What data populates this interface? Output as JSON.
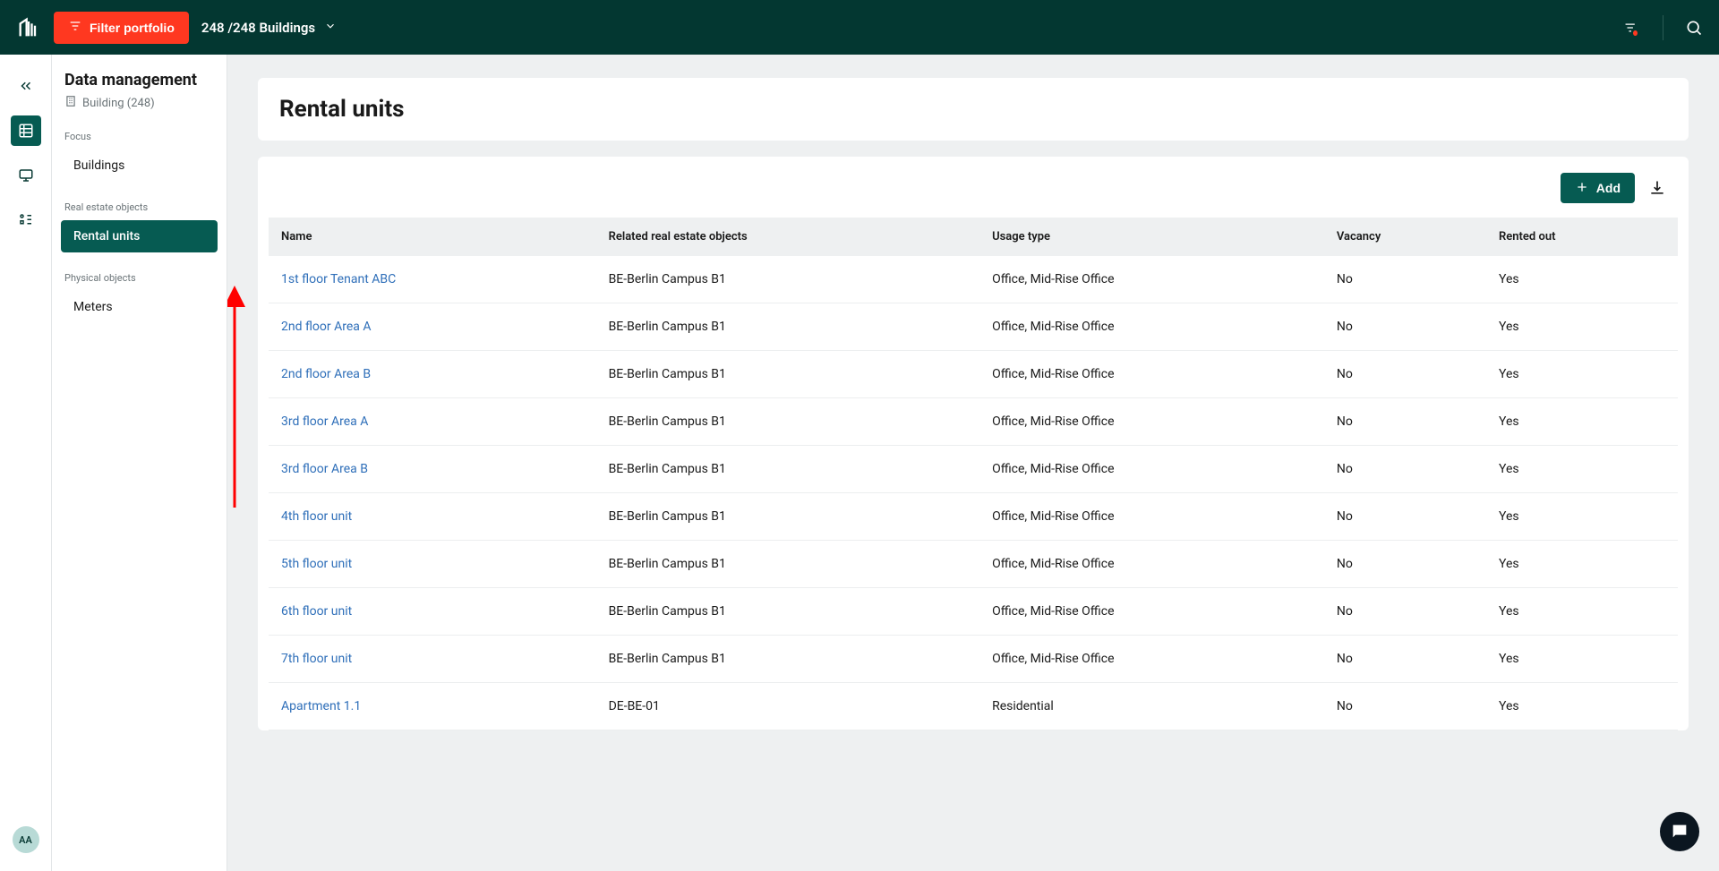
{
  "topbar": {
    "filter_label": "Filter portfolio",
    "building_count_label": "248 /248 Buildings"
  },
  "sidebar": {
    "title": "Data management",
    "subtitle": "Building (248)",
    "groups": [
      {
        "title": "Focus",
        "items": [
          {
            "label": "Buildings",
            "active": false
          }
        ]
      },
      {
        "title": "Real estate objects",
        "items": [
          {
            "label": "Rental units",
            "active": true
          }
        ]
      },
      {
        "title": "Physical objects",
        "items": [
          {
            "label": "Meters",
            "active": false
          }
        ]
      }
    ]
  },
  "rail": {
    "avatar": "AA"
  },
  "page": {
    "title": "Rental units",
    "add_label": "Add",
    "columns": [
      "Name",
      "Related real estate objects",
      "Usage type",
      "Vacancy",
      "Rented out"
    ],
    "rows": [
      {
        "name": "1st floor Tenant ABC",
        "related": "BE-Berlin Campus B1",
        "usage": "Office, Mid-Rise Office",
        "vacancy": "No",
        "rented": "Yes"
      },
      {
        "name": "2nd floor Area A",
        "related": "BE-Berlin Campus B1",
        "usage": "Office, Mid-Rise Office",
        "vacancy": "No",
        "rented": "Yes"
      },
      {
        "name": "2nd floor Area B",
        "related": "BE-Berlin Campus B1",
        "usage": "Office, Mid-Rise Office",
        "vacancy": "No",
        "rented": "Yes"
      },
      {
        "name": "3rd floor Area A",
        "related": "BE-Berlin Campus B1",
        "usage": "Office, Mid-Rise Office",
        "vacancy": "No",
        "rented": "Yes"
      },
      {
        "name": "3rd floor Area B",
        "related": "BE-Berlin Campus B1",
        "usage": "Office, Mid-Rise Office",
        "vacancy": "No",
        "rented": "Yes"
      },
      {
        "name": "4th floor unit",
        "related": "BE-Berlin Campus B1",
        "usage": "Office, Mid-Rise Office",
        "vacancy": "No",
        "rented": "Yes"
      },
      {
        "name": "5th floor unit",
        "related": "BE-Berlin Campus B1",
        "usage": "Office, Mid-Rise Office",
        "vacancy": "No",
        "rented": "Yes"
      },
      {
        "name": "6th floor unit",
        "related": "BE-Berlin Campus B1",
        "usage": "Office, Mid-Rise Office",
        "vacancy": "No",
        "rented": "Yes"
      },
      {
        "name": "7th floor unit",
        "related": "BE-Berlin Campus B1",
        "usage": "Office, Mid-Rise Office",
        "vacancy": "No",
        "rented": "Yes"
      },
      {
        "name": "Apartment 1.1",
        "related": "DE-BE-01",
        "usage": "Residential",
        "vacancy": "No",
        "rented": "Yes"
      }
    ]
  },
  "colors": {
    "brand_dark": "#033731",
    "brand_teal": "#065b52",
    "accent_red": "#ff3820",
    "link_blue": "#2f6fb9"
  }
}
